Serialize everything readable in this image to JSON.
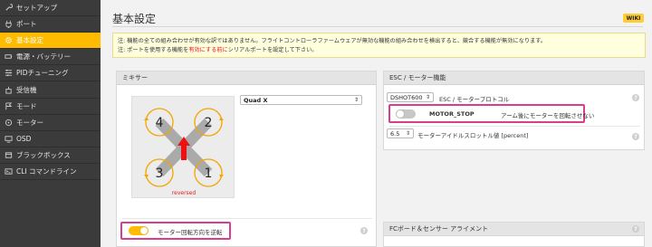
{
  "sidebar": {
    "items": [
      {
        "label": "セットアップ",
        "icon": "wrench-icon",
        "active": false
      },
      {
        "label": "ポート",
        "icon": "plug-icon",
        "active": false
      },
      {
        "label": "基本設定",
        "icon": "gear-icon",
        "active": true
      },
      {
        "label": "電源・バッテリー",
        "icon": "battery-icon",
        "active": false
      },
      {
        "label": "PIDチューニング",
        "icon": "sliders-icon",
        "active": false
      },
      {
        "label": "受信機",
        "icon": "receiver-icon",
        "active": false
      },
      {
        "label": "モード",
        "icon": "flag-icon",
        "active": false
      },
      {
        "label": "モーター",
        "icon": "motor-icon",
        "active": false
      },
      {
        "label": "OSD",
        "icon": "monitor-icon",
        "active": false
      },
      {
        "label": "ブラックボックス",
        "icon": "blackbox-icon",
        "active": false
      },
      {
        "label": "CLI コマンドライン",
        "icon": "terminal-icon",
        "active": false
      }
    ]
  },
  "header": {
    "title": "基本設定",
    "wiki_label": "WIKI"
  },
  "notice": {
    "line1": "注: 機能の全ての組み合わせが有効な訳ではありません。フライトコントローラファームウェアが無効な機能の組み合わせを検出すると、競合する機能が無効になります。",
    "line2_prefix": "注: ポートを使用する機能を",
    "line2_highlight": "有効にする前に",
    "line2_suffix": "シリアルポートを設定して下さい。"
  },
  "mixer": {
    "header": "ミキサー",
    "select_value": "Quad X",
    "motors": [
      "1",
      "2",
      "3",
      "4"
    ],
    "reversed_label": "reversed",
    "reverse_toggle_label": "モーター回転方向を逆転",
    "reverse_toggle_on": true
  },
  "esc": {
    "header": "ESC / モーター機能",
    "protocol_value": "DSHOT600",
    "protocol_label": "ESC / モータープロトコル",
    "motor_stop_label": "MOTOR_STOP",
    "motor_stop_desc": "アーム後にモーターを回転させない",
    "motor_stop_on": false,
    "idle_value": "6.5",
    "idle_label": "モーターアイドルスロットル値 [percent]"
  },
  "fc": {
    "header": "FCボード＆センサー アライメント"
  },
  "colors": {
    "accent": "#ffbb00",
    "highlight": "#d93e8e",
    "sidebar_bg": "#3b3b3b",
    "arrow": "#ee1111",
    "motor_ring": "#f5a400"
  }
}
